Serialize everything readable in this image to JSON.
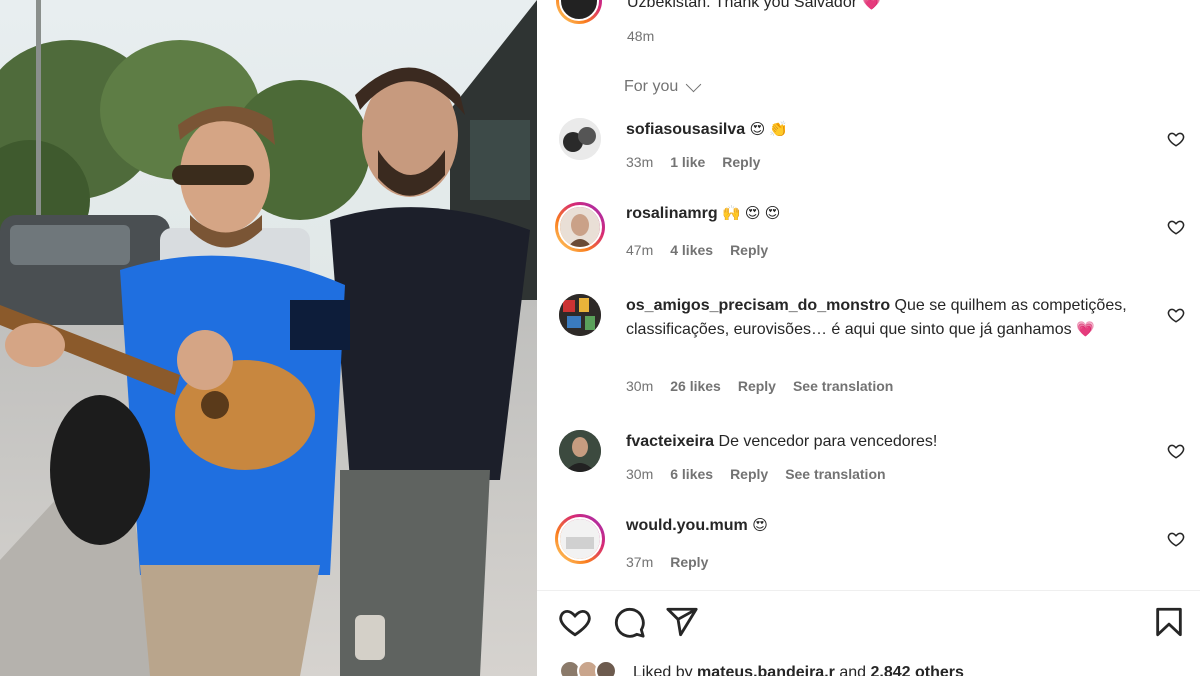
{
  "caption": {
    "text": "Uzbekistan. Thank you Salvador",
    "emoji": "💗",
    "time": "48m"
  },
  "filter": {
    "label": "For you",
    "icon": "chevron-down-icon"
  },
  "comments": [
    {
      "user": "sofiasousasilva",
      "text": "",
      "emoji": "😍 👏",
      "time": "33m",
      "likes": "1 like",
      "reply": "Reply",
      "translate": ""
    },
    {
      "user": "rosalinamrg",
      "text": "",
      "emoji": "🙌 😍 😍",
      "time": "47m",
      "likes": "4 likes",
      "reply": "Reply",
      "translate": ""
    },
    {
      "user": "os_amigos_precisam_do_monstro",
      "text": "Que se quilhem as competições, classificações, eurovisões… é aqui que sinto que já ganhamos",
      "emoji": "💗",
      "time": "30m",
      "likes": "26 likes",
      "reply": "Reply",
      "translate": "See translation"
    },
    {
      "user": "fvacteixeira",
      "text": "De vencedor para vencedores!",
      "emoji": "",
      "time": "30m",
      "likes": "6 likes",
      "reply": "Reply",
      "translate": "See translation"
    },
    {
      "user": "would.you.mum",
      "text": "",
      "emoji": "😍",
      "time": "37m",
      "likes": "",
      "reply": "Reply",
      "translate": ""
    }
  ],
  "actions": {
    "like_icon": "heart-icon",
    "comment_icon": "comment-icon",
    "share_icon": "share-icon",
    "save_icon": "bookmark-icon"
  },
  "liked_by": {
    "prefix": "Liked by",
    "user": "mateus.bandeira.r",
    "middle": "and",
    "others": "2,842 others"
  },
  "colors": {
    "heart": "#f0346e",
    "muted": "#737373",
    "text": "#262626"
  }
}
